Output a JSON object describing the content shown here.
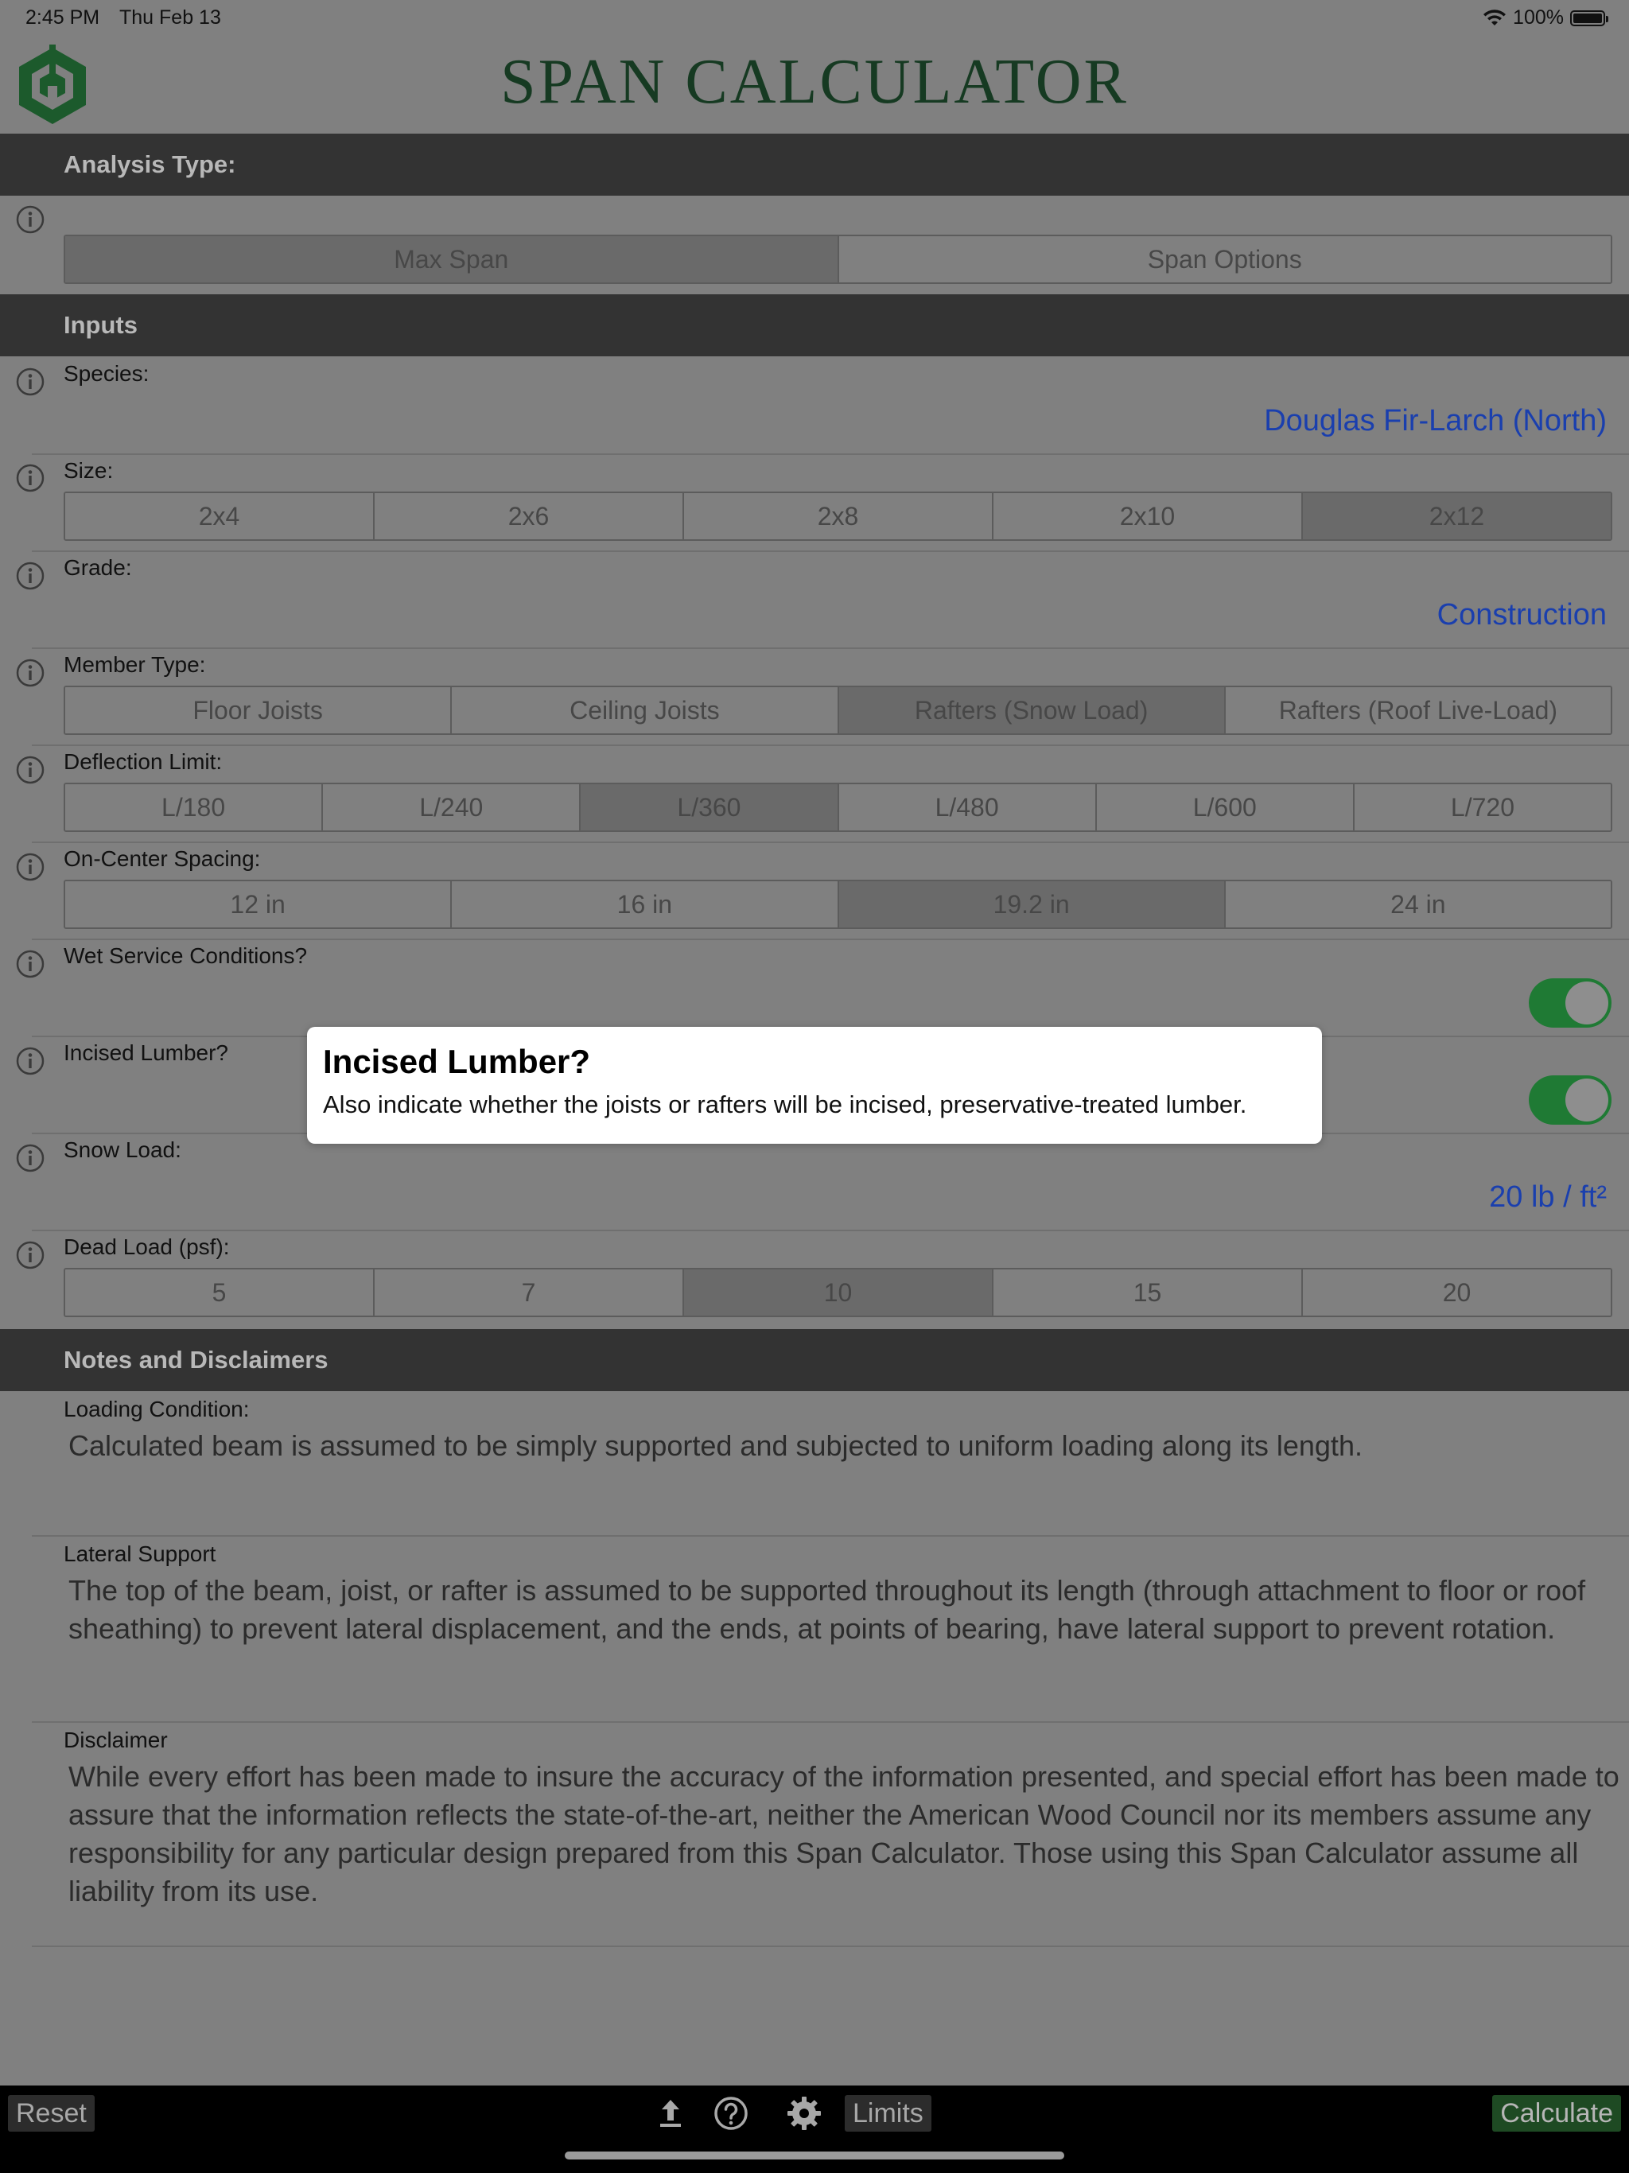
{
  "status": {
    "time": "2:45 PM",
    "date": "Thu Feb 13",
    "battery": "100%"
  },
  "app": {
    "title": "SPAN CALCULATOR"
  },
  "colors": {
    "accent_green": "#1f7a34",
    "link_blue": "#1a3fae",
    "section_bar": "#333333",
    "background": "#808080"
  },
  "sections": {
    "analysis": "Analysis Type:",
    "inputs": "Inputs",
    "notes": "Notes and Disclaimers"
  },
  "analysis_type": {
    "options": [
      "Max Span",
      "Span Options"
    ],
    "selected": "Max Span"
  },
  "species": {
    "label": "Species:",
    "value": "Douglas Fir-Larch (North)"
  },
  "size": {
    "label": "Size:",
    "options": [
      "2x4",
      "2x6",
      "2x8",
      "2x10",
      "2x12"
    ],
    "selected": "2x12"
  },
  "grade": {
    "label": "Grade:",
    "value": "Construction"
  },
  "member_type": {
    "label": "Member Type:",
    "options": [
      "Floor Joists",
      "Ceiling Joists",
      "Rafters (Snow Load)",
      "Rafters (Roof Live-Load)"
    ],
    "selected": "Rafters (Snow Load)"
  },
  "deflection": {
    "label": "Deflection Limit:",
    "options": [
      "L/180",
      "L/240",
      "L/360",
      "L/480",
      "L/600",
      "L/720"
    ],
    "selected": "L/360"
  },
  "spacing": {
    "label": "On-Center Spacing:",
    "options": [
      "12 in",
      "16 in",
      "19.2 in",
      "24 in"
    ],
    "selected": "19.2 in"
  },
  "wet_service": {
    "label": "Wet Service Conditions?",
    "on": true
  },
  "incised": {
    "label": "Incised Lumber?",
    "on": true
  },
  "snow_load": {
    "label": "Snow Load:",
    "value": "20 lb / ft²"
  },
  "dead_load": {
    "label": "Dead Load (psf):",
    "options": [
      "5",
      "7",
      "10",
      "15",
      "20"
    ],
    "selected": "10"
  },
  "popover": {
    "title": "Incised Lumber?",
    "body": "Also indicate whether the joists or rafters will be incised, preservative-treated lumber."
  },
  "notes": {
    "loading_label": "Loading Condition:",
    "loading_text": "Calculated beam is assumed to be simply supported and subjected to uniform loading along its length.",
    "lateral_label": "Lateral Support",
    "lateral_text": "The top of the beam, joist, or rafter is assumed to be supported throughout its length (through attachment to floor or roof sheathing) to prevent lateral displacement, and the ends, at points of bearing, have lateral support to prevent rotation.",
    "disclaimer_label": "Disclaimer",
    "disclaimer_text": "While every effort has been made to insure the accuracy of the information presented, and special effort has been made to assure that the information reflects the state-of-the-art, neither the American Wood Council nor its members assume any responsibility for any particular design prepared from this Span Calculator. Those using this Span Calculator assume all liability from its use."
  },
  "toolbar": {
    "reset": "Reset",
    "limits": "Limits",
    "calculate": "Calculate",
    "icons": [
      "share-icon",
      "help-icon",
      "gear-icon"
    ]
  }
}
